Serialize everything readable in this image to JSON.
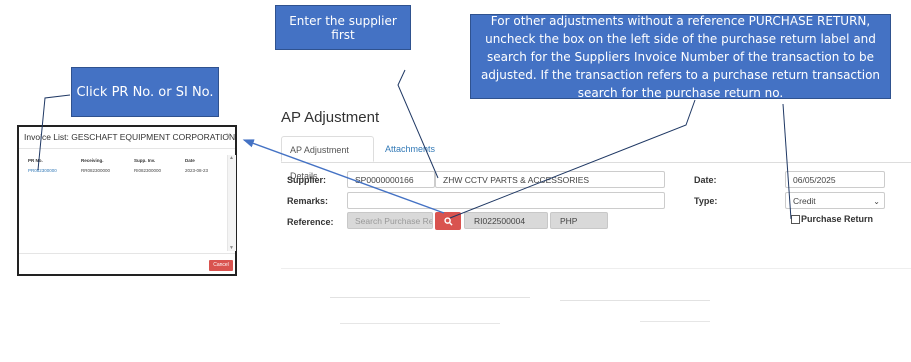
{
  "callouts": {
    "supplier_first": "Enter the supplier first",
    "click_pr": "Click PR No. or SI No.",
    "other_adjustments": "For other adjustments without a reference PURCHASE RETURN, uncheck the box on the left side of the purchase return label and search for the Suppliers Invoice Number of the transaction to be adjusted. If the transaction refers to a purchase return transaction search for the purchase return no."
  },
  "page": {
    "title": "AP Adjustment"
  },
  "tabs": [
    {
      "label": "AP Adjustment Details"
    },
    {
      "label": "Attachments"
    }
  ],
  "form": {
    "supplier_label": "Supplier:",
    "supplier_code": "SP0000000166",
    "supplier_name": "ZHW CCTV PARTS & ACCESSORIES",
    "remarks_label": "Remarks:",
    "remarks_value": "",
    "reference_label": "Reference:",
    "reference_placeholder": "Search Purchase Retu",
    "reference_value": "RI022500004",
    "currency": "PHP",
    "date_label": "Date:",
    "date_value": "06/05/2025",
    "type_label": "Type:",
    "type_value": "Credit",
    "purchase_return_label": "Purchase Return",
    "purchase_return_checked": false
  },
  "modal": {
    "title": "Invoice List: GESCHAFT EQUIPMENT CORPORATION",
    "close": "×",
    "headers": [
      "PR No.",
      "Receiving.",
      "Supp. Inv.",
      "Date"
    ],
    "row": [
      "PR082300000",
      "RR082300000",
      "RI082300000",
      "2023-08-23"
    ],
    "cancel_label": "Cancel"
  },
  "colors": {
    "callout_bg": "#4472c4",
    "danger": "#d9534f",
    "link": "#337ab7"
  }
}
